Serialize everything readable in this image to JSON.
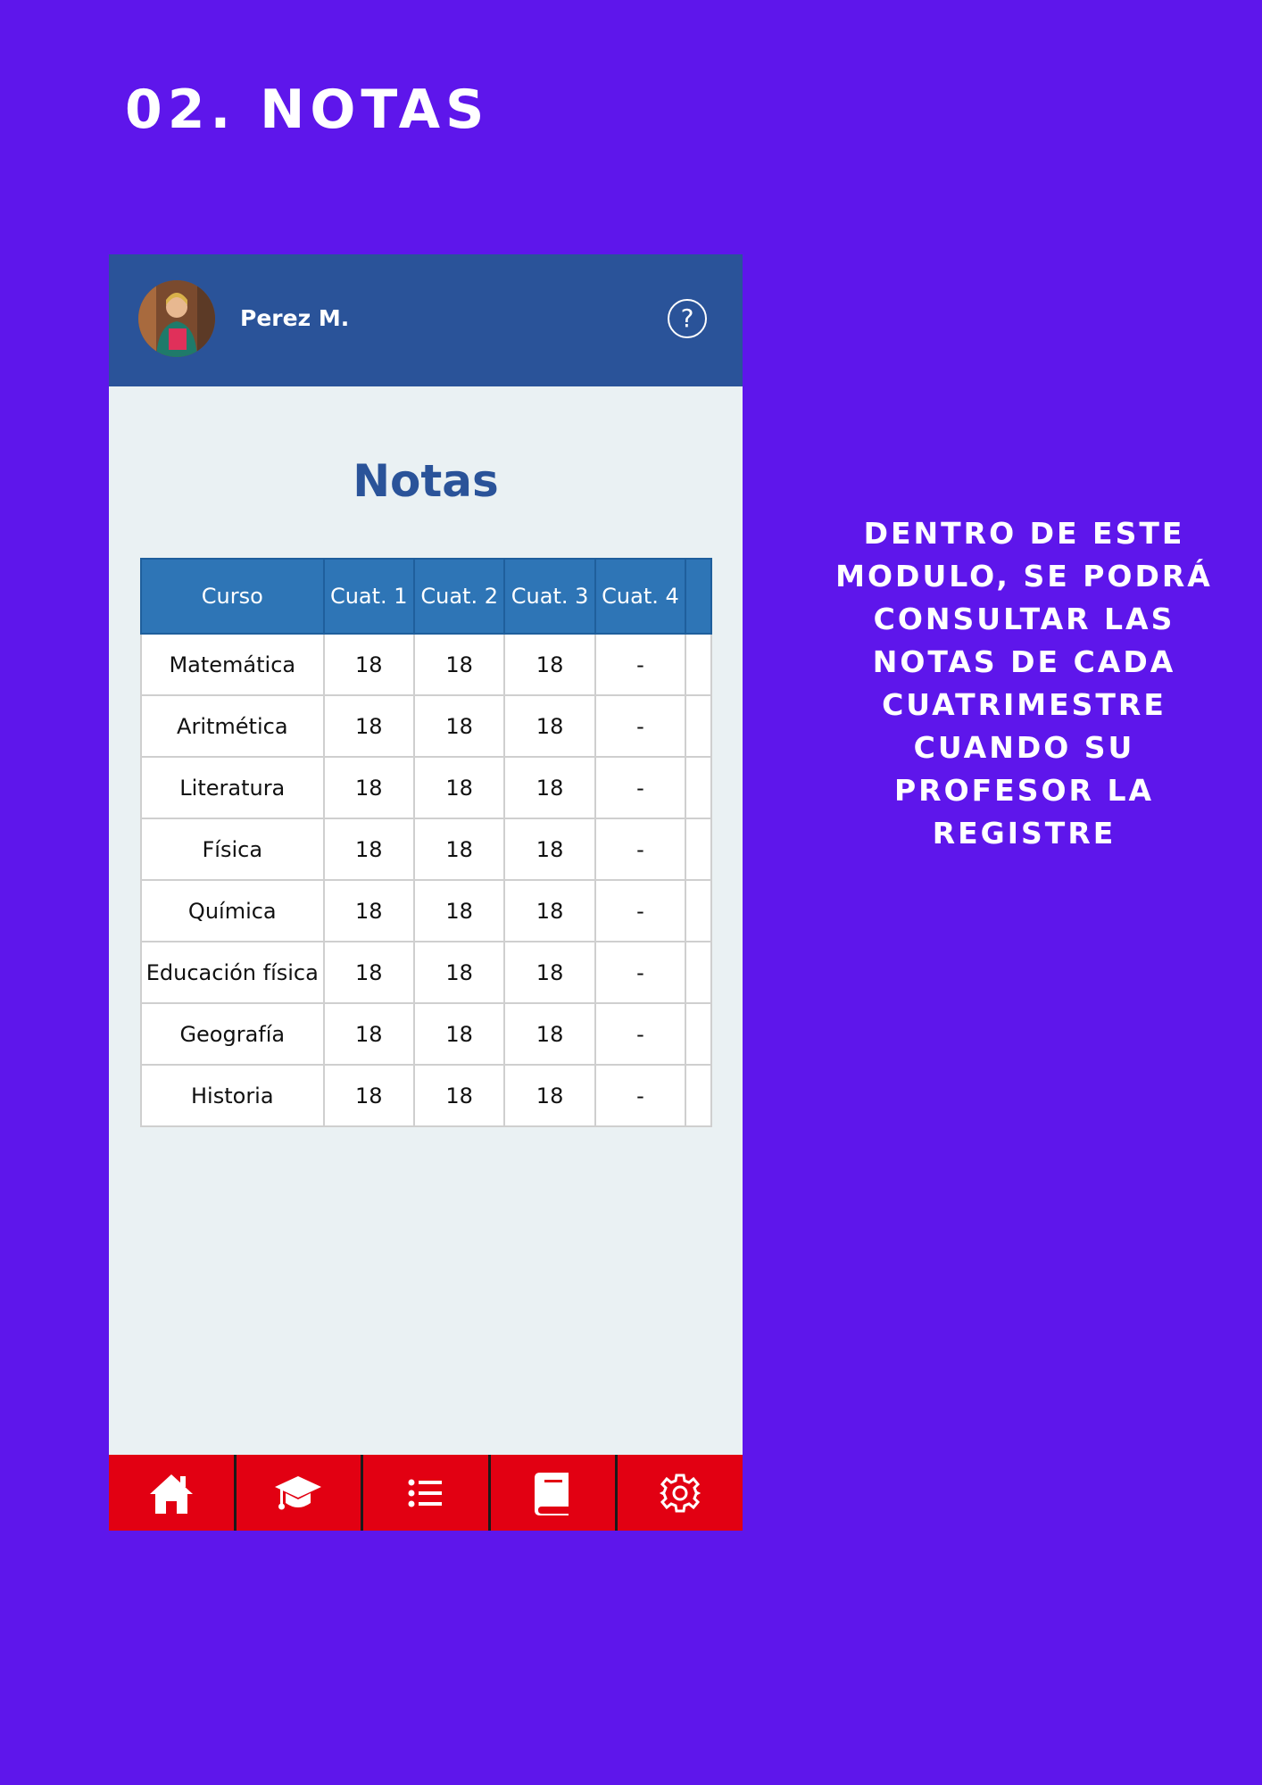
{
  "slide": {
    "title": "02. NOTAS",
    "description": "DENTRO DE ESTE\nMODULO, SE PODRÁ\nCONSULTAR LAS\nNOTAS DE CADA\nCUATRIMESTRE\nCUANDO SU\nPROFESOR LA\nREGISTRE"
  },
  "app": {
    "header": {
      "user_name": "Perez M.",
      "help_icon": "help-circle-icon"
    },
    "page_title": "Notas",
    "table": {
      "columns": [
        "Curso",
        "Cuat. 1",
        "Cuat. 2",
        "Cuat. 3",
        "Cuat. 4"
      ],
      "rows": [
        [
          "Matemática",
          "18",
          "18",
          "18",
          "-"
        ],
        [
          "Aritmética",
          "18",
          "18",
          "18",
          "-"
        ],
        [
          "Literatura",
          "18",
          "18",
          "18",
          "-"
        ],
        [
          "Física",
          "18",
          "18",
          "18",
          "-"
        ],
        [
          "Química",
          "18",
          "18",
          "18",
          "-"
        ],
        [
          "Educación física",
          "18",
          "18",
          "18",
          "-"
        ],
        [
          "Geografía",
          "18",
          "18",
          "18",
          "-"
        ],
        [
          "Historia",
          "18",
          "18",
          "18",
          "-"
        ]
      ]
    },
    "bottom_nav": [
      {
        "icon": "home-icon"
      },
      {
        "icon": "graduation-cap-icon"
      },
      {
        "icon": "list-icon"
      },
      {
        "icon": "book-icon"
      },
      {
        "icon": "gear-icon"
      }
    ]
  },
  "colors": {
    "background": "#5e16eb",
    "header": "#2a5399",
    "table_header": "#2e75b6",
    "nav": "#e20012"
  }
}
